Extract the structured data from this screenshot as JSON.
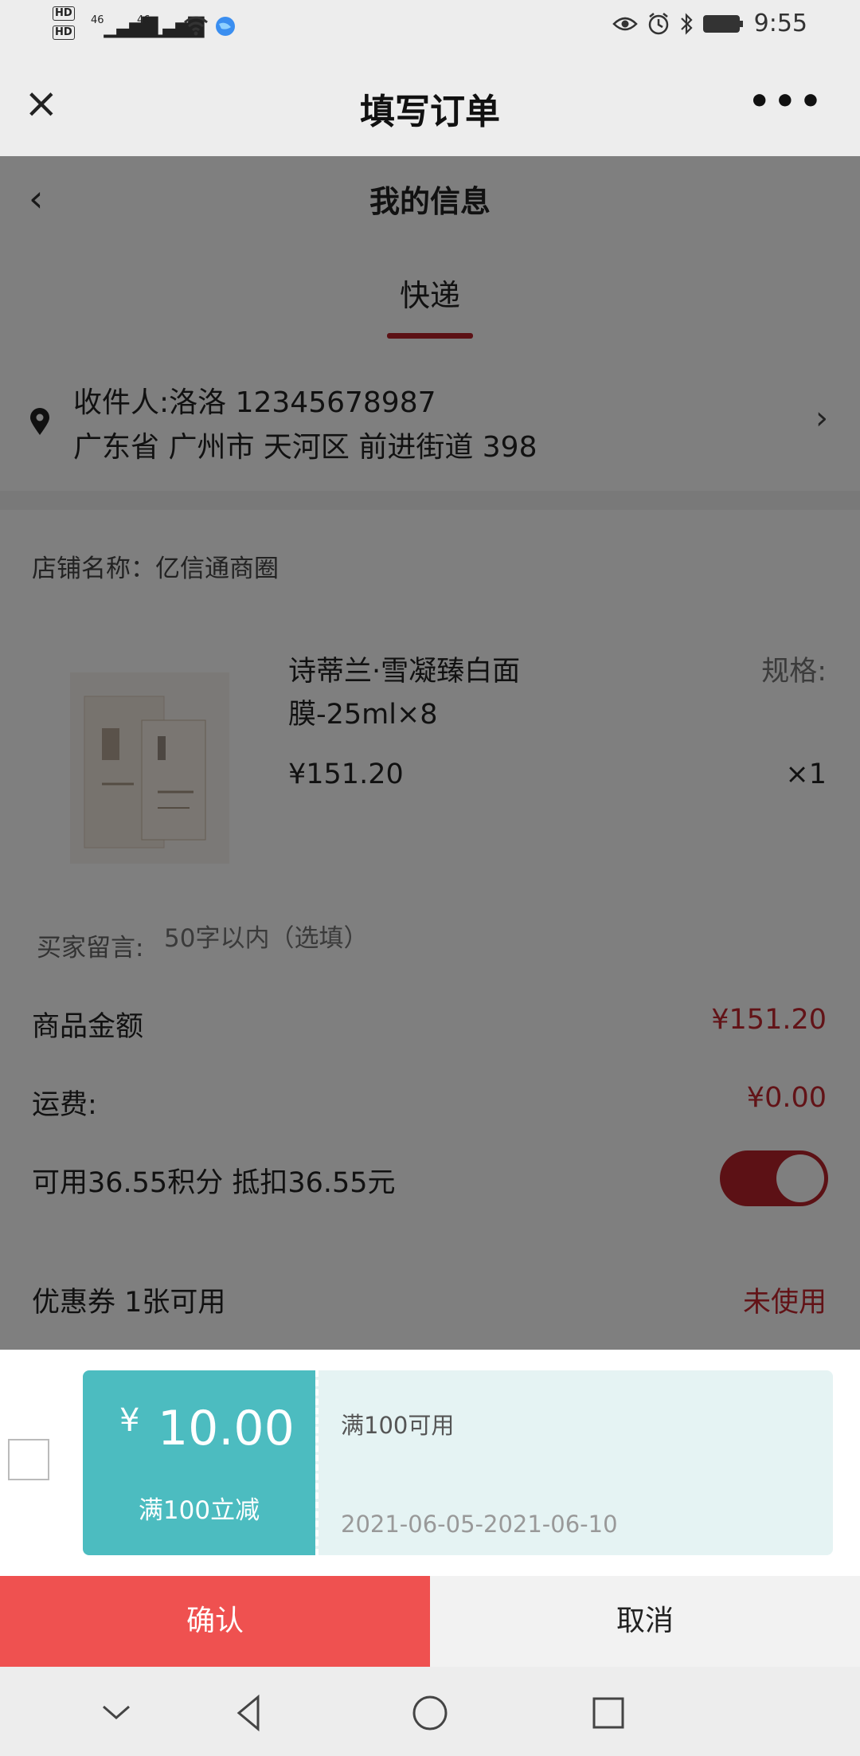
{
  "status_bar": {
    "hd1": "HD",
    "hd2": "HD",
    "net1": "46",
    "net2": "46",
    "time": "9:55",
    "icons": [
      "eye-icon",
      "alarm-icon",
      "bluetooth-icon",
      "battery-icon"
    ]
  },
  "header": {
    "close_icon": "×",
    "title": "填写订单",
    "more_icon": "•••"
  },
  "info": {
    "back_icon": "‹",
    "title": "我的信息",
    "tab": "快递"
  },
  "address": {
    "recipient": "收件人:洛洛 12345678987",
    "detail": "广东省 广州市 天河区 前进街道 398"
  },
  "shop": {
    "name": "店铺名称：亿信通商圈"
  },
  "product": {
    "name_line1": "诗蒂兰·雪凝臻白面",
    "name_line2": "膜-25ml×8",
    "spec": "规格:",
    "price": "¥151.20",
    "qty": "×1"
  },
  "note": {
    "label": "买家留言:",
    "placeholder": "50字以内（选填）"
  },
  "summary": {
    "goods_label": "商品金额",
    "goods_value": "¥151.20",
    "shipping_label": "运费:",
    "shipping_value": "¥0.00",
    "points_label": "可用36.55积分 抵扣36.55元",
    "points_enabled": true,
    "coupon_label": "优惠券 1张可用",
    "coupon_value": "未使用"
  },
  "coupon": {
    "currency": "¥",
    "amount": "10.00",
    "desc": "满100立减",
    "condition": "满100可用",
    "date": "2021-06-05-2021-06-10",
    "checked": false
  },
  "actions": {
    "confirm": "确认",
    "cancel": "取消"
  },
  "colors": {
    "accent_red": "#b8232b",
    "confirm_red": "#ef5150",
    "coupon_teal": "#4cbcc0",
    "coupon_bg": "#e5f3f3"
  }
}
